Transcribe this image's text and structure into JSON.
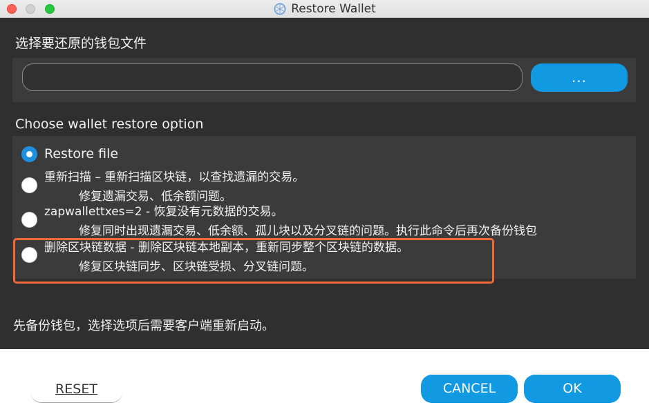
{
  "window": {
    "title": "Restore Wallet",
    "icon": "network-globe-icon"
  },
  "file_section": {
    "heading": "选择要还原的钱包文件",
    "path_value": "",
    "browse_label": "..."
  },
  "options_section": {
    "heading": "Choose wallet restore option",
    "options": [
      {
        "title": "Restore file",
        "desc": "",
        "selected": true
      },
      {
        "title": "重新扫描 – 重新扫描区块链，以查找遗漏的交易。",
        "desc": "修复遗漏交易、低余额问题。",
        "selected": false
      },
      {
        "title": "zapwallettxes=2 - 恢复没有元数据的交易。",
        "desc": "修复同时出现遗漏交易、低余额、孤儿块以及分叉链的问题。执行此命令后再次备份钱包",
        "selected": false
      },
      {
        "title": "删除区块链数据 - 删除区块链本地副本，重新同步整个区块链的数据。",
        "desc": "修复区块链同步、区块链受损、分叉链问题。",
        "selected": false
      }
    ]
  },
  "footer_note": "先备份钱包，选择选项后需要客户端重新启动。",
  "buttons": {
    "reset": "RESET",
    "cancel": "CANCEL",
    "ok": "OK"
  },
  "colors": {
    "accent": "#1199e2",
    "highlight": "#f36a36",
    "panel_bg": "#2f2f2f"
  }
}
